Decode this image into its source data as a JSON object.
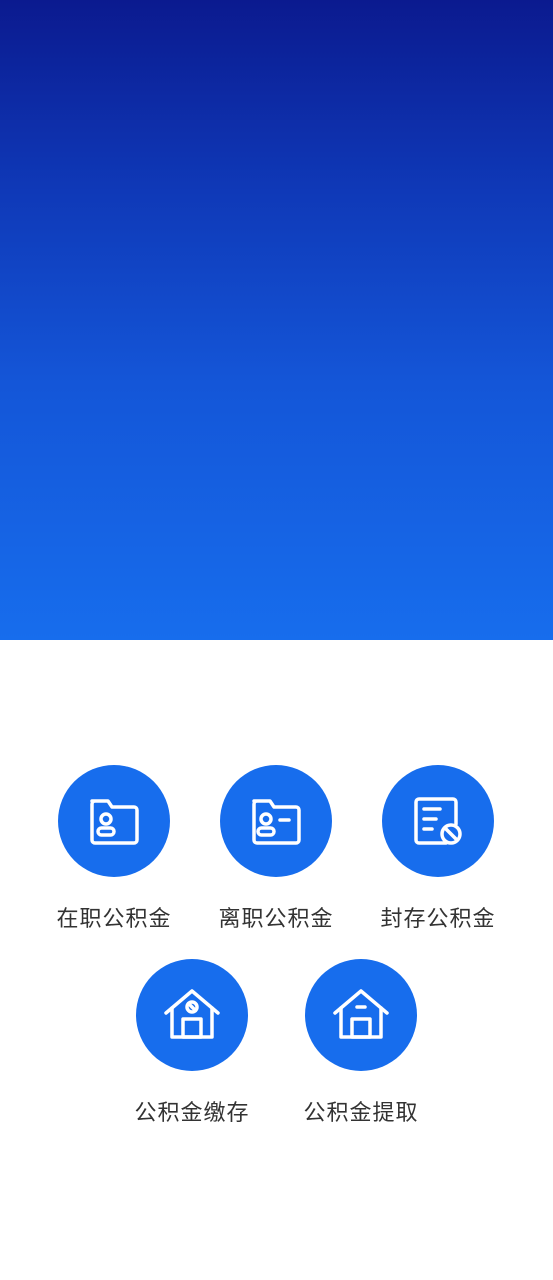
{
  "colors": {
    "accent": "#176ded",
    "hero_top": "#0b1a8f",
    "hero_bottom": "#176ded",
    "label_text": "#333333"
  },
  "menu": {
    "items": [
      {
        "label": "在职公积金",
        "icon": "employee-folder-icon"
      },
      {
        "label": "离职公积金",
        "icon": "resigned-folder-icon"
      },
      {
        "label": "封存公积金",
        "icon": "sealed-document-icon"
      },
      {
        "label": "公积金缴存",
        "icon": "house-deposit-icon"
      },
      {
        "label": "公积金提取",
        "icon": "house-withdraw-icon"
      }
    ]
  }
}
